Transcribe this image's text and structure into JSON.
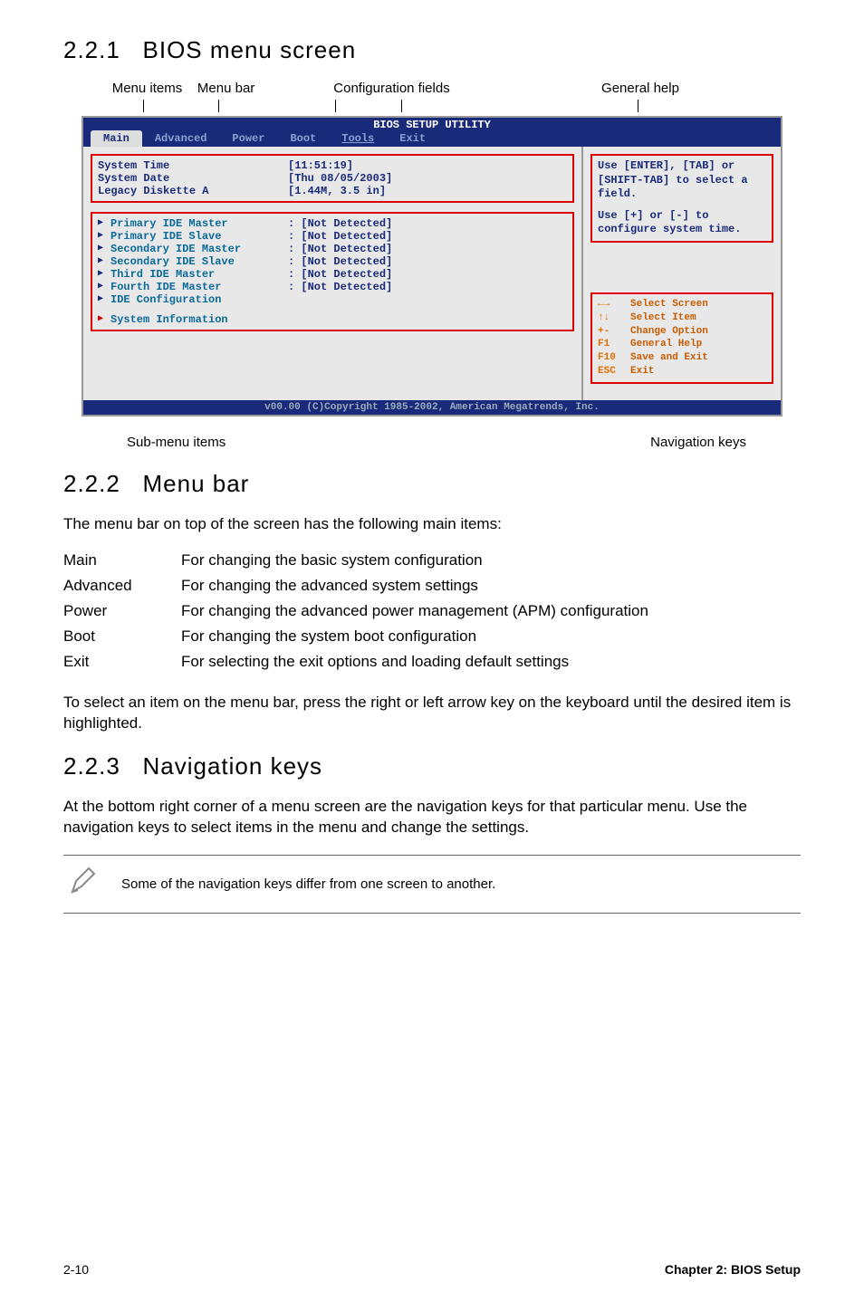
{
  "sections": {
    "s1": {
      "num": "2.2.1",
      "title": "BIOS menu screen"
    },
    "s2": {
      "num": "2.2.2",
      "title": "Menu bar"
    },
    "s3": {
      "num": "2.2.3",
      "title": "Navigation keys"
    }
  },
  "topLabels": {
    "menuItems": "Menu items",
    "menuBar": "Menu bar",
    "configFields": "Configuration fields",
    "generalHelp": "General help"
  },
  "bios": {
    "title": "BIOS SETUP UTILITY",
    "menu": [
      "Main",
      "Advanced",
      "Power",
      "Boot",
      "Tools",
      "Exit"
    ],
    "left1": [
      {
        "label": "System Time",
        "value": "[11:51:19]"
      },
      {
        "label": "System Date",
        "value": "[Thu 08/05/2003]"
      },
      {
        "label": "Legacy Diskette A",
        "value": "[1.44M, 3.5 in]"
      }
    ],
    "left2": [
      {
        "label": "Primary IDE Master",
        "value": ": [Not Detected]"
      },
      {
        "label": "Primary IDE Slave",
        "value": ": [Not Detected]"
      },
      {
        "label": "Secondary IDE Master",
        "value": ": [Not Detected]"
      },
      {
        "label": "Secondary IDE Slave",
        "value": ": [Not Detected]"
      },
      {
        "label": "Third IDE Master",
        "value": ": [Not Detected]"
      },
      {
        "label": "Fourth IDE Master",
        "value": ": [Not Detected]"
      },
      {
        "label": "IDE Configuration",
        "value": ""
      }
    ],
    "systemInfo": "System Information",
    "help1": "Use [ENTER], [TAB] or [SHIFT-TAB] to select a field.",
    "help2": "Use [+] or [-] to configure system time.",
    "nav": [
      {
        "k": "←→",
        "t": "Select Screen"
      },
      {
        "k": "↑↓",
        "t": "Select Item"
      },
      {
        "k": "+-",
        "t": "Change Option"
      },
      {
        "k": "F1",
        "t": "General Help"
      },
      {
        "k": "F10",
        "t": "Save and Exit"
      },
      {
        "k": "ESC",
        "t": "Exit"
      }
    ],
    "footer": "v00.00 (C)Copyright 1985-2002, American Megatrends, Inc."
  },
  "bottomLabels": {
    "subMenu": "Sub-menu items",
    "navKeys": "Navigation keys"
  },
  "menuBarIntro": "The menu bar on top of the screen has the following main items:",
  "menuBarDefs": [
    {
      "term": "Main",
      "def": "For changing the basic system configuration"
    },
    {
      "term": "Advanced",
      "def": "For changing the advanced system settings"
    },
    {
      "term": "Power",
      "def": "For changing the advanced power management (APM) configuration"
    },
    {
      "term": "Boot",
      "def": "For changing the system boot configuration"
    },
    {
      "term": "Exit",
      "def": "For selecting the exit options and loading default settings"
    }
  ],
  "menuBarNote": "To select an item on the menu bar, press the right or left arrow key on the keyboard until the desired item is highlighted.",
  "navKeysPara": "At the bottom right corner of a menu screen are the navigation keys for that particular menu. Use the navigation keys to select items in the menu and change the settings.",
  "noteText": "Some of the navigation keys differ from one screen to another.",
  "footer": {
    "left": "2-10",
    "right": "Chapter 2: BIOS Setup"
  }
}
